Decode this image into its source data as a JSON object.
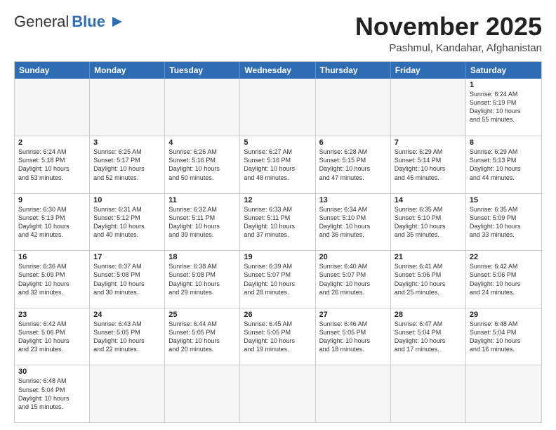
{
  "header": {
    "logo_general": "General",
    "logo_blue": "Blue",
    "month_title": "November 2025",
    "location": "Pashmul, Kandahar, Afghanistan"
  },
  "calendar": {
    "days": [
      "Sunday",
      "Monday",
      "Tuesday",
      "Wednesday",
      "Thursday",
      "Friday",
      "Saturday"
    ],
    "weeks": [
      [
        {
          "day": "",
          "info": "",
          "empty": true
        },
        {
          "day": "",
          "info": "",
          "empty": true
        },
        {
          "day": "",
          "info": "",
          "empty": true
        },
        {
          "day": "",
          "info": "",
          "empty": true
        },
        {
          "day": "",
          "info": "",
          "empty": true
        },
        {
          "day": "",
          "info": "",
          "empty": true
        },
        {
          "day": "1",
          "info": "Sunrise: 6:24 AM\nSunset: 5:19 PM\nDaylight: 10 hours\nand 55 minutes.",
          "empty": false
        }
      ],
      [
        {
          "day": "2",
          "info": "Sunrise: 6:24 AM\nSunset: 5:18 PM\nDaylight: 10 hours\nand 53 minutes.",
          "empty": false
        },
        {
          "day": "3",
          "info": "Sunrise: 6:25 AM\nSunset: 5:17 PM\nDaylight: 10 hours\nand 52 minutes.",
          "empty": false
        },
        {
          "day": "4",
          "info": "Sunrise: 6:26 AM\nSunset: 5:16 PM\nDaylight: 10 hours\nand 50 minutes.",
          "empty": false
        },
        {
          "day": "5",
          "info": "Sunrise: 6:27 AM\nSunset: 5:16 PM\nDaylight: 10 hours\nand 48 minutes.",
          "empty": false
        },
        {
          "day": "6",
          "info": "Sunrise: 6:28 AM\nSunset: 5:15 PM\nDaylight: 10 hours\nand 47 minutes.",
          "empty": false
        },
        {
          "day": "7",
          "info": "Sunrise: 6:29 AM\nSunset: 5:14 PM\nDaylight: 10 hours\nand 45 minutes.",
          "empty": false
        },
        {
          "day": "8",
          "info": "Sunrise: 6:29 AM\nSunset: 5:13 PM\nDaylight: 10 hours\nand 44 minutes.",
          "empty": false
        }
      ],
      [
        {
          "day": "9",
          "info": "Sunrise: 6:30 AM\nSunset: 5:13 PM\nDaylight: 10 hours\nand 42 minutes.",
          "empty": false
        },
        {
          "day": "10",
          "info": "Sunrise: 6:31 AM\nSunset: 5:12 PM\nDaylight: 10 hours\nand 40 minutes.",
          "empty": false
        },
        {
          "day": "11",
          "info": "Sunrise: 6:32 AM\nSunset: 5:11 PM\nDaylight: 10 hours\nand 39 minutes.",
          "empty": false
        },
        {
          "day": "12",
          "info": "Sunrise: 6:33 AM\nSunset: 5:11 PM\nDaylight: 10 hours\nand 37 minutes.",
          "empty": false
        },
        {
          "day": "13",
          "info": "Sunrise: 6:34 AM\nSunset: 5:10 PM\nDaylight: 10 hours\nand 36 minutes.",
          "empty": false
        },
        {
          "day": "14",
          "info": "Sunrise: 6:35 AM\nSunset: 5:10 PM\nDaylight: 10 hours\nand 35 minutes.",
          "empty": false
        },
        {
          "day": "15",
          "info": "Sunrise: 6:35 AM\nSunset: 5:09 PM\nDaylight: 10 hours\nand 33 minutes.",
          "empty": false
        }
      ],
      [
        {
          "day": "16",
          "info": "Sunrise: 6:36 AM\nSunset: 5:09 PM\nDaylight: 10 hours\nand 32 minutes.",
          "empty": false
        },
        {
          "day": "17",
          "info": "Sunrise: 6:37 AM\nSunset: 5:08 PM\nDaylight: 10 hours\nand 30 minutes.",
          "empty": false
        },
        {
          "day": "18",
          "info": "Sunrise: 6:38 AM\nSunset: 5:08 PM\nDaylight: 10 hours\nand 29 minutes.",
          "empty": false
        },
        {
          "day": "19",
          "info": "Sunrise: 6:39 AM\nSunset: 5:07 PM\nDaylight: 10 hours\nand 28 minutes.",
          "empty": false
        },
        {
          "day": "20",
          "info": "Sunrise: 6:40 AM\nSunset: 5:07 PM\nDaylight: 10 hours\nand 26 minutes.",
          "empty": false
        },
        {
          "day": "21",
          "info": "Sunrise: 6:41 AM\nSunset: 5:06 PM\nDaylight: 10 hours\nand 25 minutes.",
          "empty": false
        },
        {
          "day": "22",
          "info": "Sunrise: 6:42 AM\nSunset: 5:06 PM\nDaylight: 10 hours\nand 24 minutes.",
          "empty": false
        }
      ],
      [
        {
          "day": "23",
          "info": "Sunrise: 6:42 AM\nSunset: 5:06 PM\nDaylight: 10 hours\nand 23 minutes.",
          "empty": false
        },
        {
          "day": "24",
          "info": "Sunrise: 6:43 AM\nSunset: 5:05 PM\nDaylight: 10 hours\nand 22 minutes.",
          "empty": false
        },
        {
          "day": "25",
          "info": "Sunrise: 6:44 AM\nSunset: 5:05 PM\nDaylight: 10 hours\nand 20 minutes.",
          "empty": false
        },
        {
          "day": "26",
          "info": "Sunrise: 6:45 AM\nSunset: 5:05 PM\nDaylight: 10 hours\nand 19 minutes.",
          "empty": false
        },
        {
          "day": "27",
          "info": "Sunrise: 6:46 AM\nSunset: 5:05 PM\nDaylight: 10 hours\nand 18 minutes.",
          "empty": false
        },
        {
          "day": "28",
          "info": "Sunrise: 6:47 AM\nSunset: 5:04 PM\nDaylight: 10 hours\nand 17 minutes.",
          "empty": false
        },
        {
          "day": "29",
          "info": "Sunrise: 6:48 AM\nSunset: 5:04 PM\nDaylight: 10 hours\nand 16 minutes.",
          "empty": false
        }
      ],
      [
        {
          "day": "30",
          "info": "Sunrise: 6:48 AM\nSunset: 5:04 PM\nDaylight: 10 hours\nand 15 minutes.",
          "empty": false
        },
        {
          "day": "",
          "info": "",
          "empty": true
        },
        {
          "day": "",
          "info": "",
          "empty": true
        },
        {
          "day": "",
          "info": "",
          "empty": true
        },
        {
          "day": "",
          "info": "",
          "empty": true
        },
        {
          "day": "",
          "info": "",
          "empty": true
        },
        {
          "day": "",
          "info": "",
          "empty": true
        }
      ]
    ]
  },
  "colors": {
    "header_bg": "#2e6db4",
    "header_text": "#ffffff",
    "border": "#cccccc",
    "empty_bg": "#f5f5f5",
    "cell_bg": "#ffffff"
  }
}
